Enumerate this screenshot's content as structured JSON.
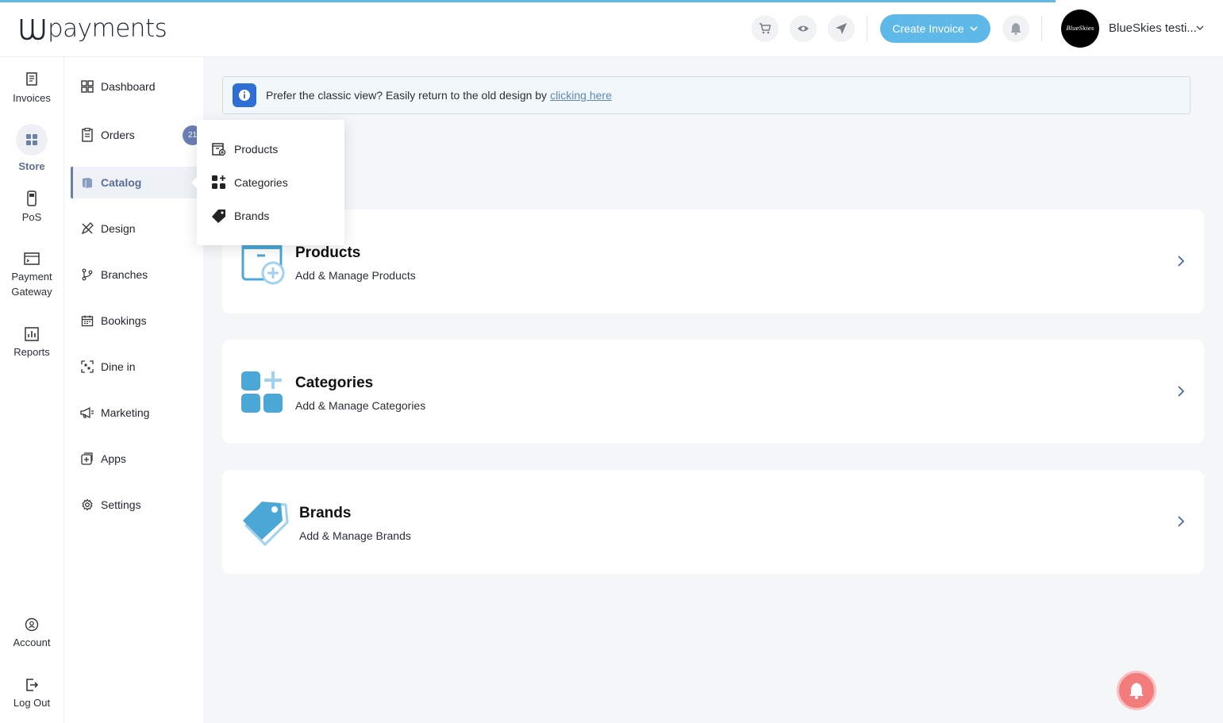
{
  "brand": {
    "logo_text": "payments"
  },
  "header": {
    "icons": [
      "cart-icon",
      "eye-icon",
      "send-icon"
    ],
    "create_invoice_label": "Create Invoice",
    "account_name": "BlueSkies testi...",
    "avatar_text": "BlueSkies"
  },
  "rail": {
    "invoices": "Invoices",
    "store": "Store",
    "pos": "PoS",
    "payment_gateway_1": "Payment",
    "payment_gateway_2": "Gateway",
    "reports": "Reports",
    "account": "Account",
    "logout": "Log Out"
  },
  "nav": {
    "dashboard": "Dashboard",
    "orders": "Orders",
    "orders_badge": "21",
    "catalog": "Catalog",
    "design": "Design",
    "branches": "Branches",
    "bookings": "Bookings",
    "dine_in": "Dine in",
    "marketing": "Marketing",
    "apps": "Apps",
    "settings": "Settings"
  },
  "flyout": {
    "products": "Products",
    "categories": "Categories",
    "brands": "Brands"
  },
  "banner": {
    "text": "Prefer the classic view? Easily return to the old design by",
    "link": "clicking here"
  },
  "cards": {
    "products": {
      "title": "Products",
      "subtitle": "Add & Manage Products"
    },
    "categories": {
      "title": "Categories",
      "subtitle": "Add & Manage Categories"
    },
    "brands": {
      "title": "Brands",
      "subtitle": "Add & Manage Brands"
    }
  },
  "colors": {
    "accent": "#5eb8e8",
    "active_nav": "#5b6e96",
    "info_icon": "#2f6ed6",
    "notification_fab": "#f27c7c"
  }
}
